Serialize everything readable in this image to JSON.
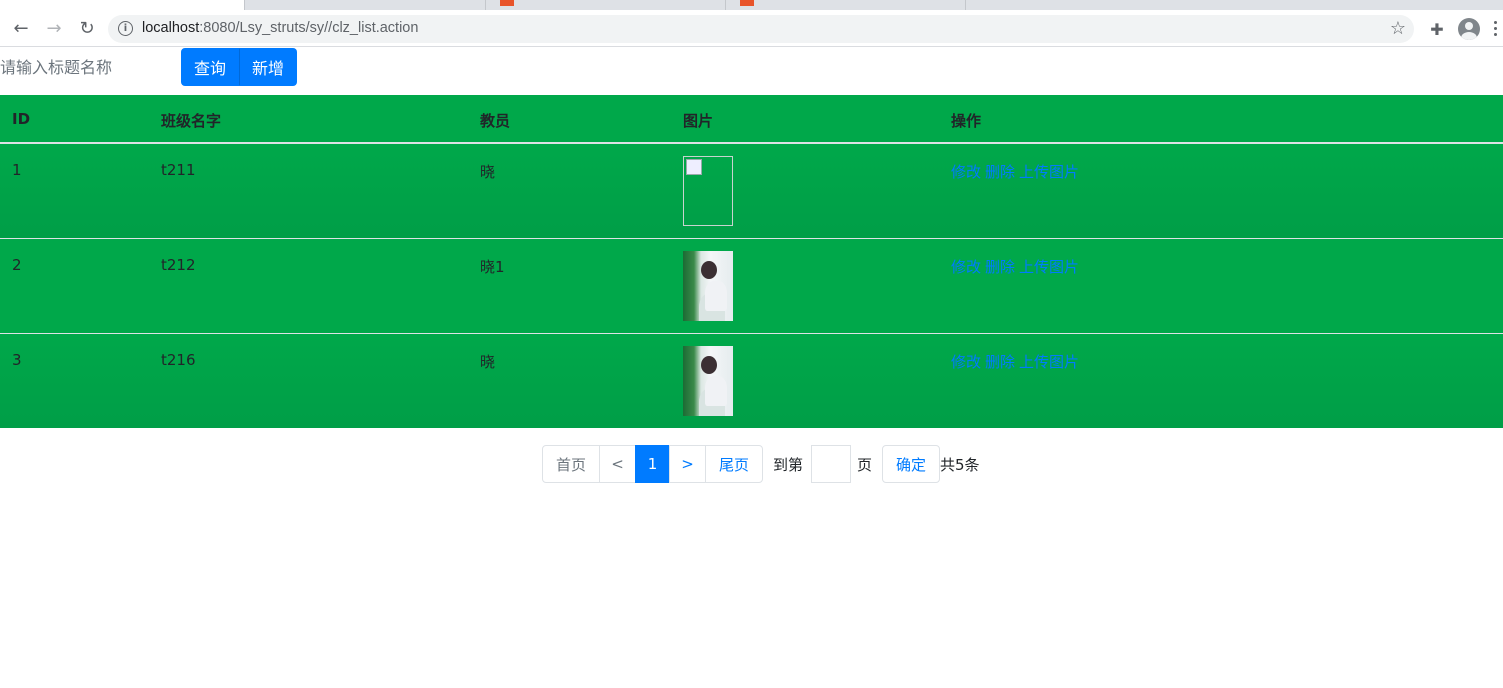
{
  "browser": {
    "url_host": "localhost",
    "url_path": ":8080/Lsy_struts/sy//clz_list.action"
  },
  "search": {
    "placeholder": "请输入标题名称",
    "query_label": "查询",
    "add_label": "新增"
  },
  "table": {
    "headers": [
      "ID",
      "班级名字",
      "教员",
      "图片",
      "操作"
    ],
    "rows": [
      {
        "id": "1",
        "name": "t211",
        "teacher": "晓",
        "image": "broken"
      },
      {
        "id": "2",
        "name": "t212",
        "teacher": "晓1",
        "image": "photo"
      },
      {
        "id": "3",
        "name": "t216",
        "teacher": "晓",
        "image": "photo"
      }
    ],
    "actions": {
      "edit": "修改",
      "delete": "删除",
      "upload": "上传图片"
    }
  },
  "pagination": {
    "first": "首页",
    "prev": "<",
    "current": "1",
    "next": ">",
    "last": "尾页",
    "goto_prefix": "到第",
    "goto_suffix": "页",
    "confirm": "确定",
    "total": "共5条"
  },
  "colors": {
    "accent": "#007bff",
    "table_bg": "#00a84a"
  }
}
